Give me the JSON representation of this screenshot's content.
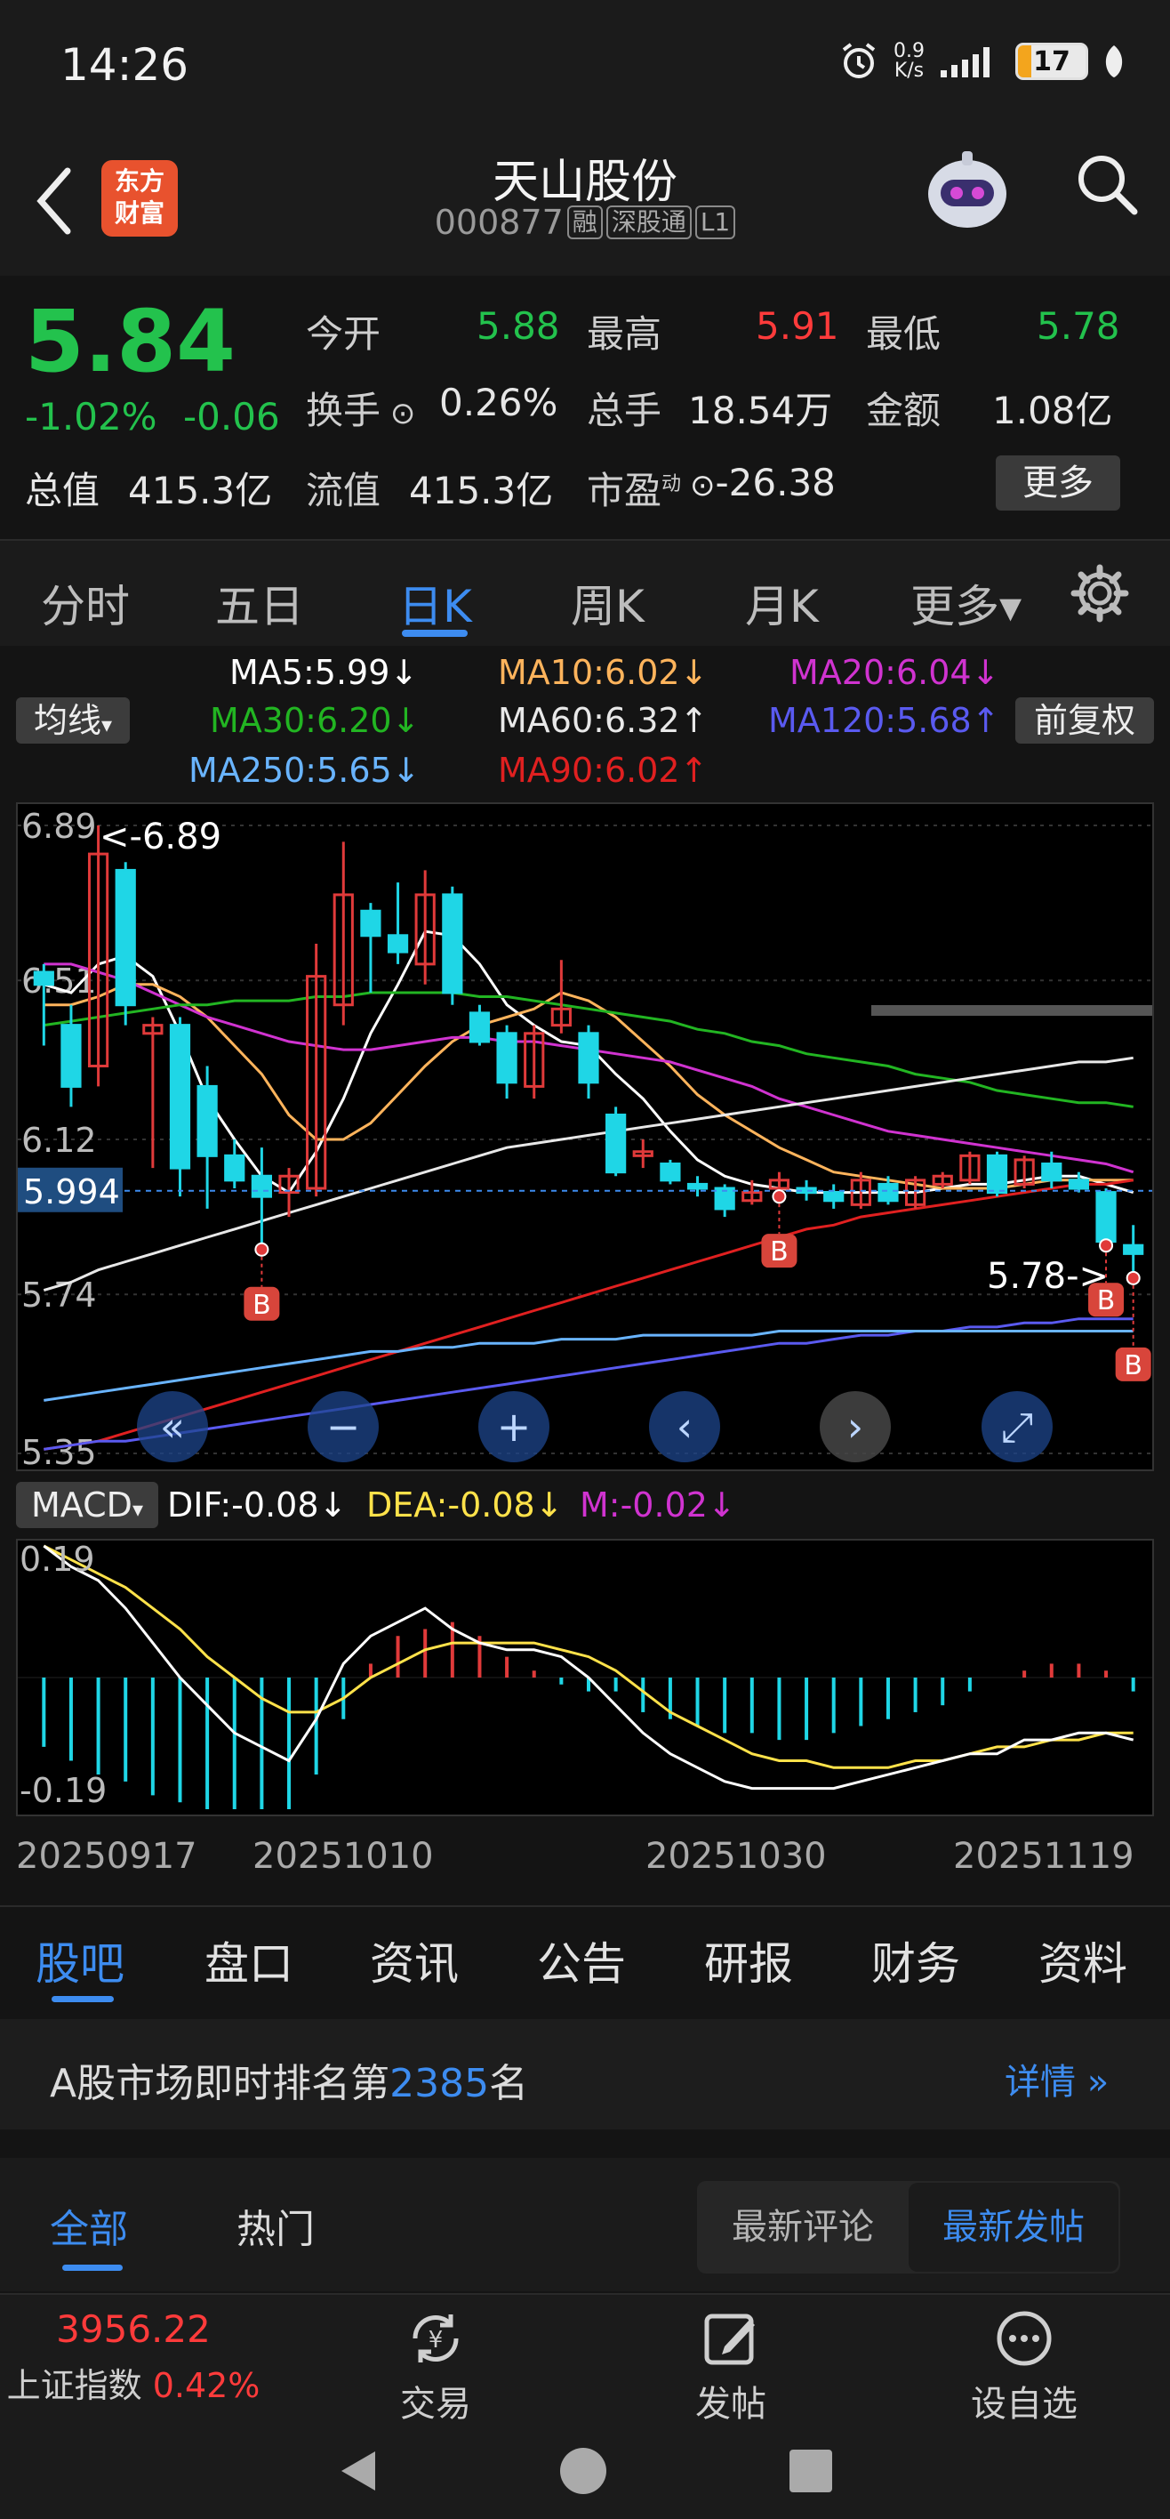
{
  "status_bar": {
    "time": "14:26",
    "net_speed_value": "0.9",
    "net_speed_unit": "K/s",
    "battery": "17"
  },
  "header": {
    "logo_line1": "东方",
    "logo_line2": "财富",
    "title": "天山股份",
    "code": "000877",
    "tags": [
      "融",
      "深股通",
      "L1"
    ]
  },
  "quote": {
    "price": "5.84",
    "change_pct": "-1.02%",
    "change": "-0.06",
    "open_label": "今开",
    "open": "5.88",
    "high_label": "最高",
    "high": "5.91",
    "low_label": "最低",
    "low": "5.78",
    "turnover_label": "换手",
    "turnover": "0.26%",
    "volume_label": "总手",
    "volume": "18.54万",
    "amount_label": "金额",
    "amount": "1.08亿",
    "mktcap_label": "总值",
    "mktcap": "415.3亿",
    "float_label": "流值",
    "float_cap": "415.3亿",
    "pe_label": "市盈",
    "pe_sup": "动",
    "pe": "-26.38",
    "more_button": "更多"
  },
  "period_tabs": {
    "items": [
      "分时",
      "五日",
      "日K",
      "周K",
      "月K",
      "更多▾"
    ],
    "active": "日K"
  },
  "ma_legend": {
    "ma5": "MA5:5.99↓",
    "ma10": "MA10:6.02↓",
    "ma20": "MA20:6.04↓",
    "ma30": "MA30:6.20↓",
    "ma60": "MA60:6.32↑",
    "ma120": "MA120:5.68↑",
    "ma250": "MA250:5.65↓",
    "ma90": "MA90:6.02↑",
    "indicator_select": "均线",
    "adjust_button": "前复权",
    "colors": {
      "ma5": "#ffffff",
      "ma10": "#ffb45c",
      "ma20": "#d033d0",
      "ma30": "#22b522",
      "ma60": "#e8e8e8",
      "ma120": "#5a5af0",
      "ma250": "#69b4ff",
      "ma90": "#e02020"
    }
  },
  "chart_data": [
    {
      "type": "candlestick",
      "title": "",
      "y_ticks": [
        "6.89",
        "6.51",
        "6.12",
        "5.74",
        "5.35"
      ],
      "ylim": [
        5.35,
        6.89
      ],
      "current_line_label": "5.994",
      "high_annotation": "<-6.89",
      "low_annotation": "5.78->",
      "up_color": "#e03a3a",
      "down_color": "#1fd6e6",
      "candles": [
        {
          "o": 6.53,
          "h": 6.55,
          "l": 6.35,
          "c": 6.5
        },
        {
          "o": 6.4,
          "h": 6.45,
          "l": 6.2,
          "c": 6.25
        },
        {
          "o": 6.3,
          "h": 6.89,
          "l": 6.25,
          "c": 6.82
        },
        {
          "o": 6.78,
          "h": 6.8,
          "l": 6.4,
          "c": 6.45
        },
        {
          "o": 6.38,
          "h": 6.42,
          "l": 6.05,
          "c": 6.4
        },
        {
          "o": 6.4,
          "h": 6.42,
          "l": 5.98,
          "c": 6.05
        },
        {
          "o": 6.25,
          "h": 6.3,
          "l": 5.95,
          "c": 6.08
        },
        {
          "o": 6.08,
          "h": 6.12,
          "l": 6.0,
          "c": 6.02
        },
        {
          "o": 6.03,
          "h": 6.1,
          "l": 5.85,
          "c": 5.98
        },
        {
          "o": 5.99,
          "h": 6.05,
          "l": 5.93,
          "c": 6.03
        },
        {
          "o": 6.0,
          "h": 6.6,
          "l": 5.98,
          "c": 6.52
        },
        {
          "o": 6.45,
          "h": 6.85,
          "l": 6.4,
          "c": 6.72
        },
        {
          "o": 6.68,
          "h": 6.7,
          "l": 6.48,
          "c": 6.62
        },
        {
          "o": 6.62,
          "h": 6.75,
          "l": 6.55,
          "c": 6.58
        },
        {
          "o": 6.55,
          "h": 6.78,
          "l": 6.5,
          "c": 6.72
        },
        {
          "o": 6.72,
          "h": 6.74,
          "l": 6.45,
          "c": 6.48
        },
        {
          "o": 6.43,
          "h": 6.45,
          "l": 6.35,
          "c": 6.36
        },
        {
          "o": 6.38,
          "h": 6.4,
          "l": 6.22,
          "c": 6.26
        },
        {
          "o": 6.25,
          "h": 6.4,
          "l": 6.22,
          "c": 6.38
        },
        {
          "o": 6.4,
          "h": 6.56,
          "l": 6.38,
          "c": 6.44
        },
        {
          "o": 6.38,
          "h": 6.4,
          "l": 6.22,
          "c": 6.26
        },
        {
          "o": 6.18,
          "h": 6.2,
          "l": 6.03,
          "c": 6.04
        },
        {
          "o": 6.08,
          "h": 6.12,
          "l": 6.05,
          "c": 6.09
        },
        {
          "o": 6.06,
          "h": 6.07,
          "l": 6.01,
          "c": 6.02
        },
        {
          "o": 6.01,
          "h": 6.03,
          "l": 5.98,
          "c": 6.0
        },
        {
          "o": 6.0,
          "h": 6.01,
          "l": 5.93,
          "c": 5.95
        },
        {
          "o": 5.97,
          "h": 6.02,
          "l": 5.96,
          "c": 5.99
        },
        {
          "o": 6.0,
          "h": 6.04,
          "l": 5.98,
          "c": 6.02
        },
        {
          "o": 6.0,
          "h": 6.02,
          "l": 5.97,
          "c": 5.99
        },
        {
          "o": 5.99,
          "h": 6.01,
          "l": 5.95,
          "c": 5.97
        },
        {
          "o": 5.96,
          "h": 6.04,
          "l": 5.95,
          "c": 6.02
        },
        {
          "o": 6.01,
          "h": 6.03,
          "l": 5.96,
          "c": 5.97
        },
        {
          "o": 5.96,
          "h": 6.03,
          "l": 5.95,
          "c": 6.02
        },
        {
          "o": 6.01,
          "h": 6.04,
          "l": 6.0,
          "c": 6.03
        },
        {
          "o": 6.02,
          "h": 6.09,
          "l": 6.01,
          "c": 6.08
        },
        {
          "o": 6.08,
          "h": 6.09,
          "l": 5.98,
          "c": 5.99
        },
        {
          "o": 6.01,
          "h": 6.08,
          "l": 6.0,
          "c": 6.07
        },
        {
          "o": 6.06,
          "h": 6.09,
          "l": 6.0,
          "c": 6.02
        },
        {
          "o": 6.02,
          "h": 6.04,
          "l": 5.99,
          "c": 6.0
        },
        {
          "o": 5.99,
          "h": 6.0,
          "l": 5.86,
          "c": 5.87
        },
        {
          "o": 5.86,
          "h": 5.91,
          "l": 5.78,
          "c": 5.84
        }
      ],
      "lines": [
        {
          "name": "MA5",
          "color": "#ffffff",
          "values": [
            6.5,
            6.48,
            6.55,
            6.57,
            6.52,
            6.38,
            6.22,
            6.12,
            6.03,
            5.99,
            6.09,
            6.22,
            6.38,
            6.5,
            6.63,
            6.62,
            6.55,
            6.45,
            6.4,
            6.36,
            6.35,
            6.28,
            6.22,
            6.14,
            6.07,
            6.03,
            6.01,
            6.0,
            5.99,
            5.99,
            5.99,
            5.99,
            5.99,
            6.0,
            6.01,
            6.01,
            6.02,
            6.03,
            6.03,
            6.01,
            5.99
          ]
        },
        {
          "name": "MA10",
          "color": "#ffb45c",
          "values": [
            6.45,
            6.45,
            6.47,
            6.5,
            6.5,
            6.47,
            6.42,
            6.35,
            6.28,
            6.18,
            6.12,
            6.12,
            6.16,
            6.23,
            6.3,
            6.36,
            6.4,
            6.42,
            6.44,
            6.48,
            6.46,
            6.42,
            6.36,
            6.3,
            6.23,
            6.18,
            6.14,
            6.1,
            6.07,
            6.04,
            6.03,
            6.02,
            6.01,
            6.0,
            6.0,
            6.0,
            6.01,
            6.02,
            6.02,
            6.02,
            6.02
          ]
        },
        {
          "name": "MA20",
          "color": "#d033d0",
          "values": [
            6.55,
            6.55,
            6.53,
            6.51,
            6.48,
            6.45,
            6.42,
            6.4,
            6.38,
            6.36,
            6.35,
            6.34,
            6.34,
            6.35,
            6.36,
            6.37,
            6.37,
            6.36,
            6.36,
            6.35,
            6.34,
            6.33,
            6.32,
            6.31,
            6.29,
            6.27,
            6.25,
            6.22,
            6.2,
            6.18,
            6.16,
            6.14,
            6.13,
            6.12,
            6.11,
            6.1,
            6.09,
            6.08,
            6.07,
            6.06,
            6.04
          ]
        },
        {
          "name": "MA30",
          "color": "#22b522",
          "values": [
            6.4,
            6.41,
            6.42,
            6.43,
            6.44,
            6.45,
            6.45,
            6.46,
            6.46,
            6.46,
            6.47,
            6.47,
            6.48,
            6.48,
            6.48,
            6.48,
            6.47,
            6.47,
            6.46,
            6.45,
            6.44,
            6.43,
            6.42,
            6.41,
            6.39,
            6.38,
            6.36,
            6.35,
            6.33,
            6.32,
            6.31,
            6.3,
            6.28,
            6.27,
            6.26,
            6.24,
            6.23,
            6.22,
            6.21,
            6.21,
            6.2
          ]
        },
        {
          "name": "MA60",
          "color": "#e8e8e8",
          "values": [
            5.75,
            5.77,
            5.8,
            5.82,
            5.84,
            5.86,
            5.88,
            5.9,
            5.92,
            5.94,
            5.96,
            5.98,
            6.0,
            6.02,
            6.04,
            6.06,
            6.08,
            6.1,
            6.11,
            6.12,
            6.13,
            6.14,
            6.15,
            6.16,
            6.17,
            6.18,
            6.19,
            6.2,
            6.21,
            6.22,
            6.23,
            6.24,
            6.25,
            6.26,
            6.27,
            6.28,
            6.29,
            6.3,
            6.31,
            6.31,
            6.32
          ]
        },
        {
          "name": "MA90",
          "color": "#e02020",
          "values": [
            5.36,
            5.37,
            5.38,
            5.4,
            5.42,
            5.44,
            5.46,
            5.48,
            5.5,
            5.52,
            5.54,
            5.56,
            5.58,
            5.6,
            5.62,
            5.64,
            5.66,
            5.68,
            5.7,
            5.72,
            5.74,
            5.76,
            5.78,
            5.8,
            5.82,
            5.84,
            5.86,
            5.88,
            5.9,
            5.91,
            5.93,
            5.94,
            5.95,
            5.96,
            5.97,
            5.98,
            5.99,
            6.0,
            6.01,
            6.01,
            6.02
          ]
        },
        {
          "name": "MA120",
          "color": "#5a5af0",
          "values": [
            5.36,
            5.37,
            5.38,
            5.38,
            5.39,
            5.4,
            5.41,
            5.42,
            5.43,
            5.44,
            5.45,
            5.46,
            5.47,
            5.48,
            5.49,
            5.5,
            5.51,
            5.52,
            5.53,
            5.54,
            5.55,
            5.56,
            5.57,
            5.58,
            5.59,
            5.6,
            5.61,
            5.62,
            5.62,
            5.63,
            5.64,
            5.64,
            5.65,
            5.65,
            5.66,
            5.66,
            5.67,
            5.67,
            5.68,
            5.68,
            5.68
          ]
        },
        {
          "name": "MA250",
          "color": "#69b4ff",
          "values": [
            5.48,
            5.49,
            5.5,
            5.51,
            5.52,
            5.53,
            5.54,
            5.55,
            5.56,
            5.57,
            5.58,
            5.59,
            5.6,
            5.6,
            5.61,
            5.61,
            5.62,
            5.62,
            5.62,
            5.63,
            5.63,
            5.63,
            5.64,
            5.64,
            5.64,
            5.64,
            5.64,
            5.65,
            5.65,
            5.65,
            5.65,
            5.65,
            5.65,
            5.65,
            5.65,
            5.65,
            5.65,
            5.65,
            5.65,
            5.65,
            5.65
          ]
        }
      ],
      "buy_markers": [
        8,
        27,
        39,
        40
      ]
    },
    {
      "type": "bar_line",
      "title": "",
      "y_ticks": [
        "0.19",
        "-0.19"
      ],
      "ylim": [
        -0.19,
        0.19
      ],
      "histogram": [
        -0.1,
        -0.12,
        -0.14,
        -0.15,
        -0.17,
        -0.18,
        -0.19,
        -0.19,
        -0.19,
        -0.19,
        -0.14,
        -0.06,
        0.02,
        0.06,
        0.07,
        0.08,
        0.06,
        0.03,
        0.01,
        -0.01,
        -0.02,
        -0.02,
        -0.05,
        -0.06,
        -0.07,
        -0.08,
        -0.08,
        -0.09,
        -0.09,
        -0.08,
        -0.07,
        -0.06,
        -0.05,
        -0.04,
        -0.02,
        0.0,
        0.01,
        0.02,
        0.02,
        0.01,
        -0.02
      ],
      "dif": [
        0.19,
        0.16,
        0.14,
        0.1,
        0.05,
        0.0,
        -0.04,
        -0.08,
        -0.1,
        -0.12,
        -0.06,
        0.02,
        0.06,
        0.08,
        0.1,
        0.07,
        0.05,
        0.04,
        0.04,
        0.03,
        0.0,
        -0.04,
        -0.08,
        -0.11,
        -0.13,
        -0.15,
        -0.16,
        -0.16,
        -0.16,
        -0.16,
        -0.15,
        -0.14,
        -0.13,
        -0.12,
        -0.11,
        -0.11,
        -0.09,
        -0.09,
        -0.08,
        -0.08,
        -0.09
      ],
      "dea": [
        0.19,
        0.17,
        0.15,
        0.13,
        0.1,
        0.07,
        0.03,
        0.0,
        -0.03,
        -0.05,
        -0.05,
        -0.03,
        0.0,
        0.02,
        0.04,
        0.05,
        0.05,
        0.05,
        0.05,
        0.04,
        0.03,
        0.01,
        -0.02,
        -0.05,
        -0.07,
        -0.09,
        -0.11,
        -0.12,
        -0.12,
        -0.13,
        -0.13,
        -0.13,
        -0.12,
        -0.12,
        -0.11,
        -0.1,
        -0.1,
        -0.09,
        -0.09,
        -0.08,
        -0.08
      ],
      "dif_color": "#ffffff",
      "dea_color": "#ffe24a",
      "pos_color": "#e03a3a",
      "neg_color": "#1fd6e6"
    }
  ],
  "macd_row": {
    "select": "MACD",
    "dif": "DIF:-0.08↓",
    "dea": "DEA:-0.08↓",
    "m": "M:-0.02↓"
  },
  "dates": [
    "20250917",
    "20251010",
    "20251030",
    "20251119"
  ],
  "sub_tabs": {
    "items": [
      "股吧",
      "盘口",
      "资讯",
      "公告",
      "研报",
      "财务",
      "资料"
    ],
    "active": "股吧"
  },
  "rank": {
    "prefix": "A股市场即时排名第",
    "number": "2385",
    "suffix": "名",
    "detail_link": "详情"
  },
  "feed_tabs": {
    "all": "全部",
    "hot": "热门",
    "latest_comments": "最新评论",
    "latest_posts": "最新发帖"
  },
  "bottom_nav": {
    "index_value": "3956.22",
    "index_name": "上证指数",
    "index_change": "0.42%",
    "trade": "交易",
    "post": "发帖",
    "watchlist": "设自选"
  }
}
